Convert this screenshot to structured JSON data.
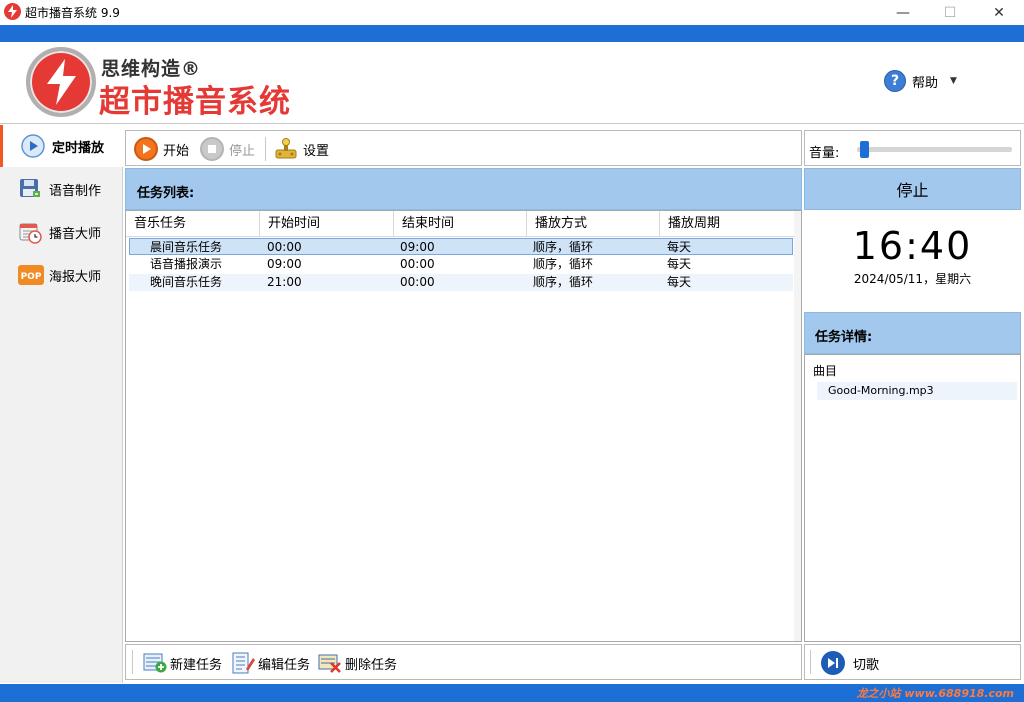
{
  "window": {
    "title": "超市播音系统 9.9",
    "min_glyph": "—",
    "max_glyph": "☐",
    "close_glyph": "✕"
  },
  "brand": {
    "company": "思维构造®",
    "product": "超市播音系统",
    "accent_color": "#e53935"
  },
  "help": {
    "icon_glyph": "?",
    "label": "帮助"
  },
  "sidebar": {
    "items": [
      {
        "label": "定时播放",
        "icon": "play-circle-icon"
      },
      {
        "label": "语音制作",
        "icon": "floppy-disk-icon"
      },
      {
        "label": "播音大师",
        "icon": "calendar-clock-icon"
      },
      {
        "label": "海报大师",
        "icon": "pop-poster-icon"
      }
    ]
  },
  "toolbar": {
    "start_label": "开始",
    "stop_label": "停止",
    "settings_label": "设置"
  },
  "tasks": {
    "header": "任务列表:",
    "columns": [
      "音乐任务",
      "开始时间",
      "结束时间",
      "播放方式",
      "播放周期"
    ],
    "rows": [
      {
        "name": "晨间音乐任务",
        "start": "00:00",
        "end": "09:00",
        "mode": "顺序，循环",
        "cycle": "每天"
      },
      {
        "name": "语音播报演示",
        "start": "09:00",
        "end": "00:00",
        "mode": "顺序，循环",
        "cycle": "每天"
      },
      {
        "name": "晚间音乐任务",
        "start": "21:00",
        "end": "00:00",
        "mode": "顺序，循环",
        "cycle": "每天"
      }
    ]
  },
  "task_actions": {
    "new_label": "新建任务",
    "edit_label": "编辑任务",
    "delete_label": "删除任务"
  },
  "volume": {
    "label": "音量:",
    "level": 0.02
  },
  "status": {
    "state": "停止",
    "time": "16:40",
    "date": "2024/05/11，星期六"
  },
  "detail": {
    "header": "任务详情:",
    "section": "曲目",
    "songs": [
      "Good-Morning.mp3"
    ]
  },
  "player": {
    "next_label": "切歌"
  },
  "watermark": "龙之小站 www.688918.com",
  "colors": {
    "title_blue": "#1d6fd6",
    "panel_header": "#a3c8ee",
    "active_marker": "#f05a22"
  }
}
